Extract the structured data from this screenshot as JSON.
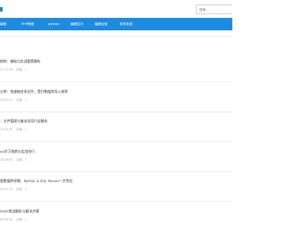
{
  "search": {
    "placeholder": "搜索..."
  },
  "nav": {
    "items": [
      {
        "label": "编程"
      },
      {
        "label": "PHP教程"
      },
      {
        "label": "python"
      },
      {
        "label": "编程技巧"
      },
      {
        "label": "编程经验"
      },
      {
        "label": "软件系统"
      }
    ]
  },
  "articles": [
    {
      "title": "结构：基础与实战要素解析",
      "date": "11:17:33",
      "views": "阅读：1"
    },
    {
      "title": "分库：快速梳合多文件，提升数据库导入效率",
      "date": "10:00:57",
      "views": "阅读：1"
    },
    {
      "title": "：文件管理与基本实用巧全解析",
      "date": "10:44:55",
      "views": "阅读：1"
    },
    {
      "title": "ux学习指南与实战技巧",
      "date": "10:26:00",
      "views": "阅读：2"
    },
    {
      "title": "版数据库攻略：MySQL & SQL Server一步到位",
      "date": "09:21:15",
      "views": "阅读：2"
    },
    {
      "title": "5505错误解析与解决步骤",
      "date": "09:09:45",
      "views": "阅读：1"
    }
  ]
}
